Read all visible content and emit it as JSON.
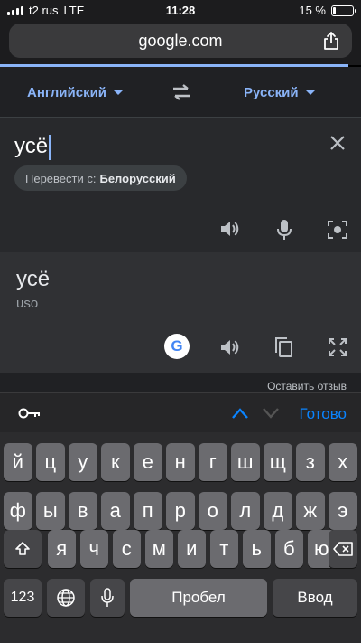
{
  "status_bar": {
    "carrier": "t2 rus",
    "network": "LTE",
    "time": "11:28",
    "battery_text": "15 %",
    "battery_level": 0.15
  },
  "browser": {
    "url": "google.com"
  },
  "translate": {
    "source_lang": "Английский",
    "target_lang": "Русский",
    "input_text": "усё",
    "detect_prefix": "Перевести с:",
    "detected_lang": "Белорусский",
    "result_text": "усё",
    "transliteration": "uso",
    "feedback": "Оставить отзыв"
  },
  "keyboard": {
    "done_label": "Готово",
    "row1": [
      "й",
      "ц",
      "у",
      "к",
      "е",
      "н",
      "г",
      "ш",
      "щ",
      "з",
      "х"
    ],
    "row2": [
      "ф",
      "ы",
      "в",
      "а",
      "п",
      "р",
      "о",
      "л",
      "д",
      "ж",
      "э"
    ],
    "row3": [
      "я",
      "ч",
      "с",
      "м",
      "и",
      "т",
      "ь",
      "б",
      "ю"
    ],
    "numbers_label": "123",
    "space_label": "Пробел",
    "enter_label": "Ввод"
  },
  "colors": {
    "accent": "#8ab4f8",
    "done": "#0a84ff",
    "card": "#28292c",
    "result_card": "#303134"
  }
}
